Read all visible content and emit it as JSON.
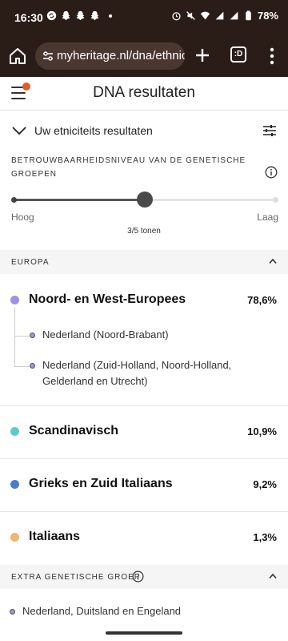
{
  "status_bar": {
    "time": "16:30",
    "battery": "78%",
    "left_icons": [
      "sync-icon",
      "snapchat-icon",
      "snapchat-icon",
      "snapchat-icon"
    ],
    "right_icons": [
      "alarm-icon",
      "mute-icon",
      "wifi-icon",
      "signal-icon",
      "signal-icon",
      "battery-icon"
    ]
  },
  "browser": {
    "url": "myheritage.nl/dna/ethnic",
    "tabs_label": ":D"
  },
  "header": {
    "title": "DNA resultaten"
  },
  "ethnicity": {
    "section_label": "Uw etniciteits resultaten",
    "confidence_label": "BETROUWBAARHEIDSNIVEAU VAN DE GENETISCHE GROEPEN",
    "slider": {
      "high_label": "Hoog",
      "low_label": "Laag",
      "count_label": "3/5 tonen",
      "level": 3,
      "max": 5
    }
  },
  "europe": {
    "header": "EUROPA",
    "regions": [
      {
        "name": "Noord- en West-Europees",
        "percent": "78,6%",
        "color": "#9c92e6",
        "subregions": [
          "Nederland (Noord-Brabant)",
          "Nederland (Zuid-Holland, Noord-Holland, Gelderland en Utrecht)"
        ]
      },
      {
        "name": "Scandinavisch",
        "percent": "10,9%",
        "color": "#5ec8d6"
      },
      {
        "name": "Grieks en Zuid Italiaans",
        "percent": "9,2%",
        "color": "#4a7bd0"
      },
      {
        "name": "Italiaans",
        "percent": "1,3%",
        "color": "#f2b56d"
      }
    ]
  },
  "extra": {
    "header": "EXTRA GENETISCHE GROEP",
    "items": [
      "Nederland, Duitsland en Engeland"
    ]
  }
}
